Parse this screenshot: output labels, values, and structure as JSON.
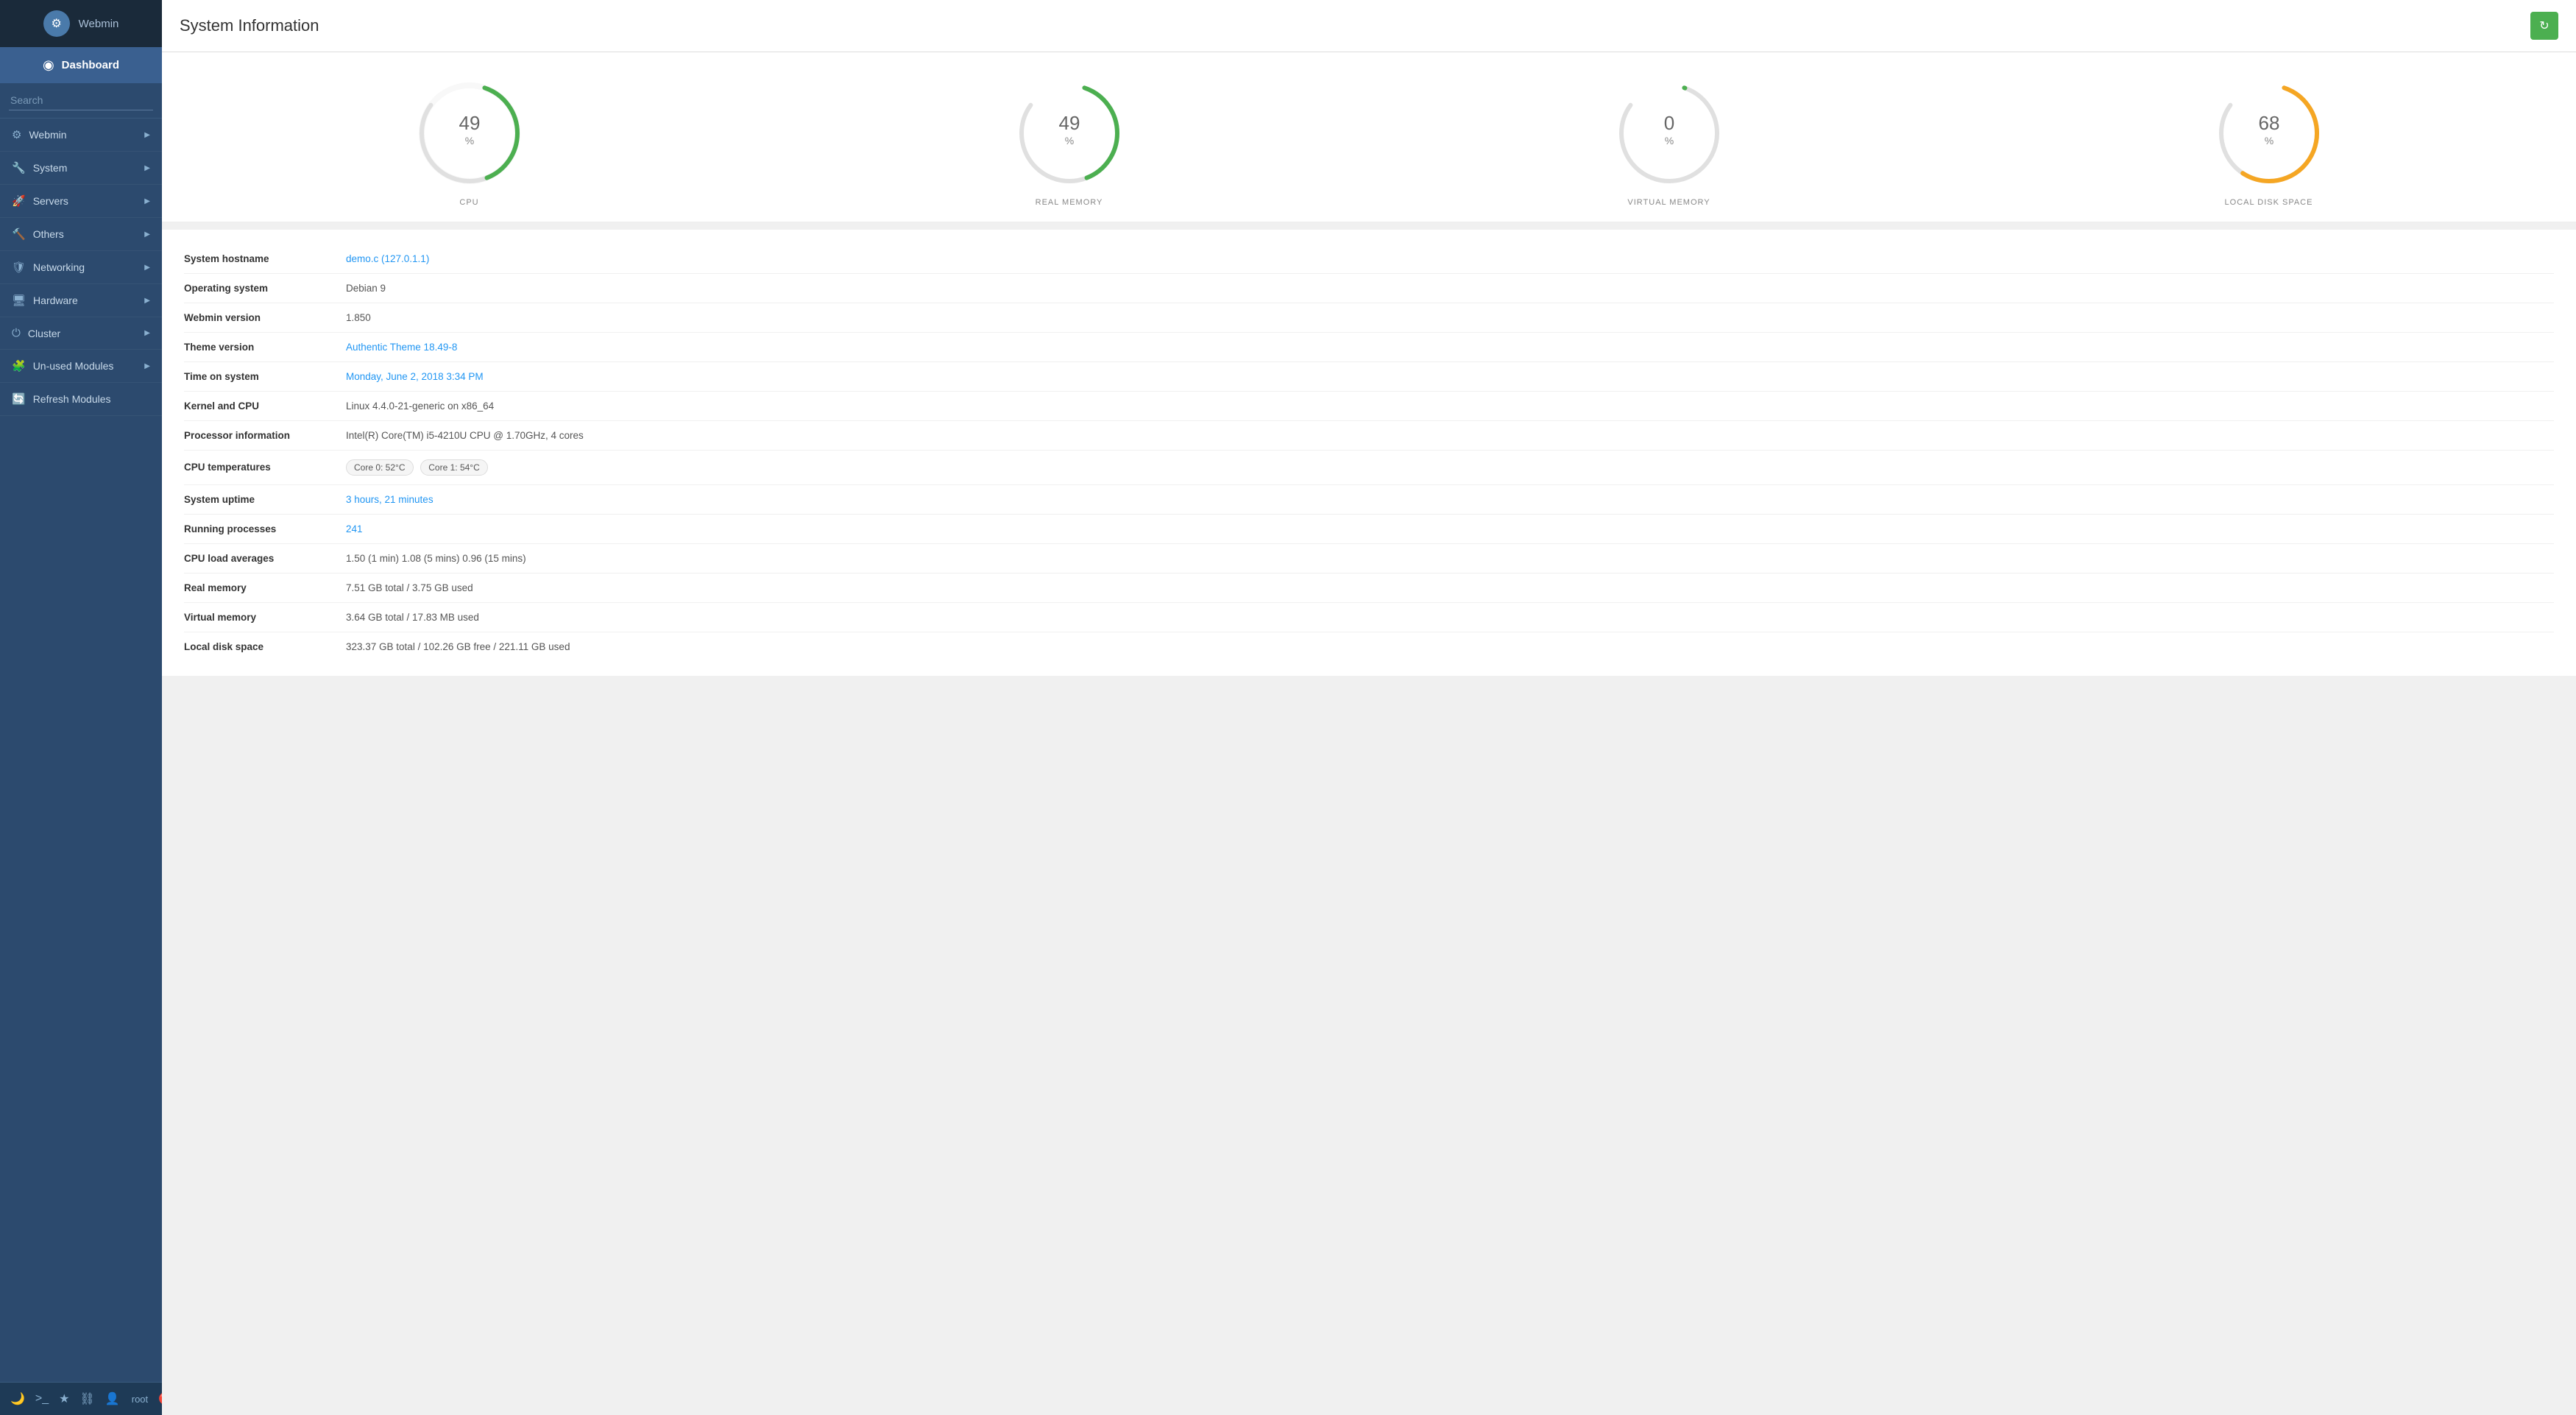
{
  "sidebar": {
    "webmin_label": "Webmin",
    "dashboard_label": "Dashboard",
    "search_placeholder": "Search",
    "nav_items": [
      {
        "id": "webmin",
        "label": "Webmin",
        "icon": "⚙"
      },
      {
        "id": "system",
        "label": "System",
        "icon": "🔧"
      },
      {
        "id": "servers",
        "label": "Servers",
        "icon": "🚀"
      },
      {
        "id": "others",
        "label": "Others",
        "icon": "🔨"
      },
      {
        "id": "networking",
        "label": "Networking",
        "icon": "🛡"
      },
      {
        "id": "hardware",
        "label": "Hardware",
        "icon": "🖥"
      },
      {
        "id": "cluster",
        "label": "Cluster",
        "icon": "⏻"
      },
      {
        "id": "unused-modules",
        "label": "Un-used Modules",
        "icon": "🧩"
      },
      {
        "id": "refresh-modules",
        "label": "Refresh Modules",
        "icon": "🔄"
      }
    ],
    "bottom_tools": [
      "🌙",
      ">_",
      "★",
      "⛓",
      "👤"
    ],
    "root_label": "root",
    "logout_icon": "🔴"
  },
  "header": {
    "title": "System Information",
    "refresh_label": "↻"
  },
  "gauges": [
    {
      "id": "cpu",
      "percent": 49,
      "label": "CPU",
      "color": "#4caf50",
      "bg": "#e8e8e8"
    },
    {
      "id": "real-memory",
      "percent": 49,
      "label": "REAL MEMORY",
      "color": "#4caf50",
      "bg": "#e8e8e8"
    },
    {
      "id": "virtual-memory",
      "percent": 0,
      "label": "VIRTUAL MEMORY",
      "color": "#4caf50",
      "bg": "#e8e8e8"
    },
    {
      "id": "local-disk",
      "percent": 68,
      "label": "LOCAL DISK SPACE",
      "color": "#f5a623",
      "bg": "#e8e8e8"
    }
  ],
  "info": {
    "rows": [
      {
        "key": "System hostname",
        "val": "demo.c  (127.0.1.1)",
        "type": "link"
      },
      {
        "key": "Operating system",
        "val": "Debian 9",
        "type": "normal"
      },
      {
        "key": "Webmin version",
        "val": "1.850",
        "type": "normal"
      },
      {
        "key": "Theme version",
        "val": "Authentic Theme 18.49-8",
        "type": "link"
      },
      {
        "key": "Time on system",
        "val": "Monday, June 2, 2018 3:34 PM",
        "type": "highlight"
      },
      {
        "key": "Kernel and CPU",
        "val": "Linux 4.4.0-21-generic on x86_64",
        "type": "normal"
      },
      {
        "key": "Processor information",
        "val": "Intel(R) Core(TM) i5-4210U CPU @ 1.70GHz, 4 cores",
        "type": "normal"
      },
      {
        "key": "CPU temperatures",
        "val": "temps",
        "type": "temps"
      },
      {
        "key": "System uptime",
        "val": "3 hours, 21 minutes",
        "type": "highlight"
      },
      {
        "key": "Running processes",
        "val": "241",
        "type": "highlight"
      },
      {
        "key": "CPU load averages",
        "val": "1.50 (1 min) 1.08 (5 mins) 0.96 (15 mins)",
        "type": "normal"
      },
      {
        "key": "Real memory",
        "val": "7.51 GB total / 3.75 GB used",
        "type": "normal"
      },
      {
        "key": "Virtual memory",
        "val": "3.64 GB total / 17.83 MB used",
        "type": "normal"
      },
      {
        "key": "Local disk space",
        "val": "323.37 GB total / 102.26 GB free / 221.11 GB used",
        "type": "normal"
      }
    ],
    "temp_badges": [
      "Core 0: 52°C",
      "Core 1: 54°C"
    ]
  }
}
